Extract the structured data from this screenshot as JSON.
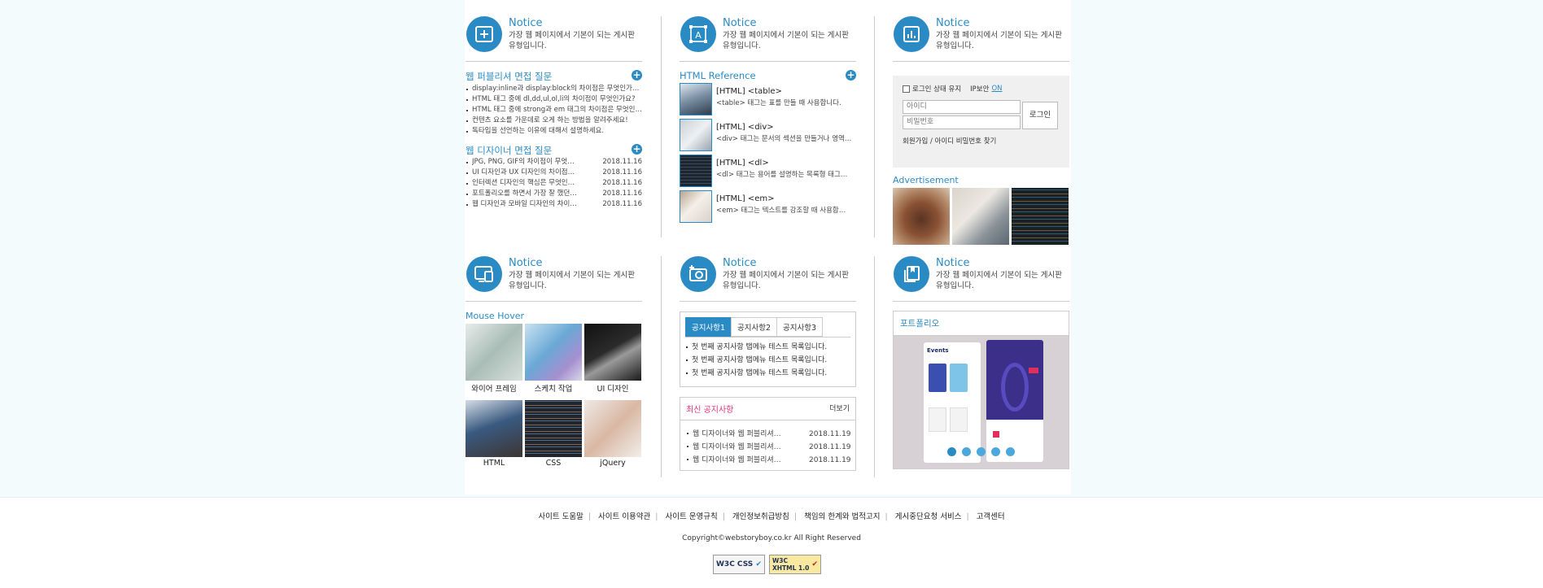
{
  "colors": {
    "accent": "#2a8bc4",
    "pink": "#e0307a"
  },
  "notice": {
    "title": "Notice",
    "desc": "가장 웹 페이지에서 기본이 되는 게시판 유형입니다."
  },
  "col1": {
    "sec1": {
      "title": "웹 퍼블리셔 면접 질문",
      "items": [
        "display:inline과 display:block의 차이점은 무엇인가요?",
        "HTML 태그 중에 dl,dd,ul,ol,li의 차이점이 무엇인가요?",
        "HTML 태그 중에 strong과 em 태그의 차이점은 무엇인가요?",
        "컨텐츠 요소를 가운데로 오게 하는 방법을 알려주세요!",
        "독타입을 선언하는 이유에 대해서 설명하세요."
      ]
    },
    "sec2": {
      "title": "웹 디자이너 면접 질문",
      "items": [
        {
          "t": "JPG, PNG, GIF의 차이점이 무엇인가요?",
          "d": "2018.11.16"
        },
        {
          "t": "UI 디자인과 UX 디자인의 차이점은?",
          "d": "2018.11.16"
        },
        {
          "t": "인터렉션 디자인의 핵심은 무엇인가요?",
          "d": "2018.11.16"
        },
        {
          "t": "포트폴리오를 하면서 가장 잘 했던 점은?",
          "d": "2018.11.16"
        },
        {
          "t": "웹 디자인과 모바일 디자인의 차이점은?",
          "d": "2018.11.16"
        }
      ]
    }
  },
  "col2": {
    "title": "HTML Reference",
    "items": [
      {
        "t": "[HTML] <table>",
        "d": "<table> 태그는 표를 만들 때 사용합니다."
      },
      {
        "t": "[HTML] <div>",
        "d": "<div> 태그는 문서의 섹션을 만들거나 영역을 나눌 때 사용합니다."
      },
      {
        "t": "[HTML] <dl>",
        "d": "<dl> 태그는 용어를 설명하는 목록형 태그입니다."
      },
      {
        "t": "[HTML] <em>",
        "d": "<em> 태그는 텍스트를 강조할 때 사용합니다."
      }
    ]
  },
  "col3": {
    "keep": "로그인 상태 유지",
    "ip": "IP보안",
    "ip_on": "ON",
    "id_ph": "아이디",
    "pw_ph": "비밀번호",
    "login": "로그인",
    "links": "회원가입 / 아이디 비밀번호 찾기",
    "ad": "Advertisement"
  },
  "col4": {
    "title": "Mouse Hover",
    "caps": [
      "와이어 프레임",
      "스케치 작업",
      "UI 디자인",
      "HTML",
      "CSS",
      "jQuery"
    ]
  },
  "col5": {
    "tabs": [
      "공지사항1",
      "공지사항2",
      "공지사항3"
    ],
    "tab_items": [
      "첫 번째 공지사항 탭메뉴 테스트 목록입니다.",
      "첫 번째 공지사항 탭메뉴 테스트 목록입니다.",
      "첫 번째 공지사항 탭메뉴 테스트 목록입니다."
    ],
    "latest_title": "최신 공지사항",
    "more": "더보기",
    "latest": [
      {
        "t": "웹 디자이너와 웹 퍼블리셔의 차이",
        "d": "2018.11.19"
      },
      {
        "t": "웹 디자이너와 웹 퍼블리셔의 차이",
        "d": "2018.11.19"
      },
      {
        "t": "웹 디자이너와 웹 퍼블리셔의 차이",
        "d": "2018.11.19"
      }
    ]
  },
  "col6": {
    "title": "포트폴리오",
    "events": "Events"
  },
  "footer": {
    "links": [
      "사이트 도움말",
      "사이트 이용약관",
      "사이트 운영규칙",
      "개인정보취급방침",
      "책임의 한계와 법적고지",
      "게시중단요청 서비스",
      "고객센터"
    ],
    "copy": "Copyright©webstoryboy.co.kr All Right Reserved",
    "badges": [
      "W3C CSS",
      "W3C XHTML 1.0"
    ]
  }
}
